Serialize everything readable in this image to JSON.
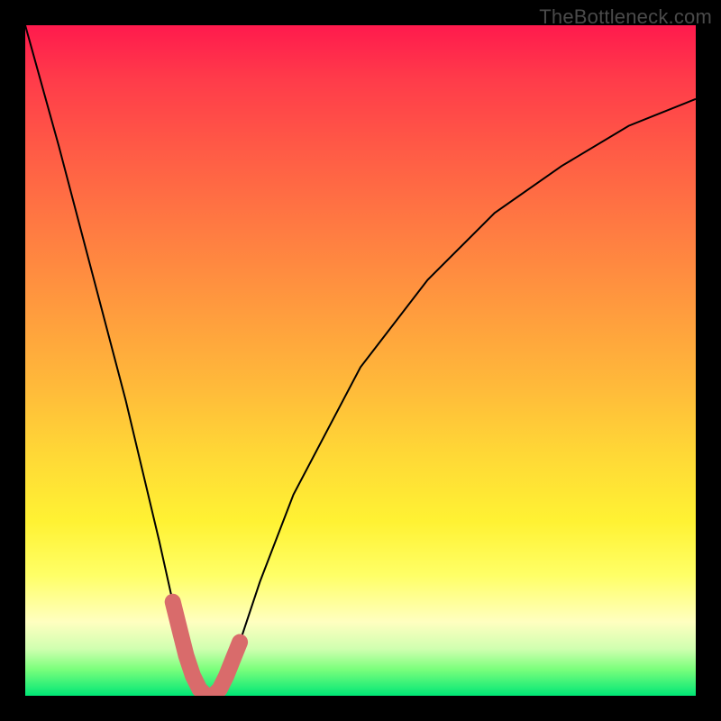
{
  "watermark": "TheBottleneck.com",
  "chart_data": {
    "type": "line",
    "title": "",
    "xlabel": "",
    "ylabel": "",
    "xlim": [
      0,
      100
    ],
    "ylim": [
      0,
      100
    ],
    "grid": false,
    "legend": false,
    "series": [
      {
        "name": "curve",
        "color": "#000000",
        "stroke_width": 2,
        "x": [
          0,
          5,
          10,
          15,
          20,
          22,
          24,
          26,
          27,
          28,
          29,
          32,
          35,
          40,
          50,
          60,
          70,
          80,
          90,
          100
        ],
        "y_percent": [
          100,
          82,
          63,
          44,
          23,
          14,
          6,
          1,
          0,
          0,
          1,
          8,
          17,
          30,
          49,
          62,
          72,
          79,
          85,
          89
        ]
      },
      {
        "name": "notch-highlight",
        "color": "#d96b6b",
        "stroke_width": 12,
        "x": [
          22.0,
          23.0,
          24.0,
          25.0,
          26.0,
          27.0,
          28.0,
          29.0,
          30.0,
          31.0,
          32.0
        ],
        "y_percent": [
          14.0,
          10.0,
          6.0,
          3.0,
          1.0,
          0.0,
          0.0,
          1.0,
          3.0,
          5.5,
          8.0
        ]
      }
    ],
    "background_gradient": {
      "orientation": "vertical",
      "stops": [
        {
          "pos": 0.0,
          "color": "#ff1a4d"
        },
        {
          "pos": 0.5,
          "color": "#ffba3a"
        },
        {
          "pos": 0.78,
          "color": "#ffff55"
        },
        {
          "pos": 1.0,
          "color": "#00e676"
        }
      ]
    }
  }
}
